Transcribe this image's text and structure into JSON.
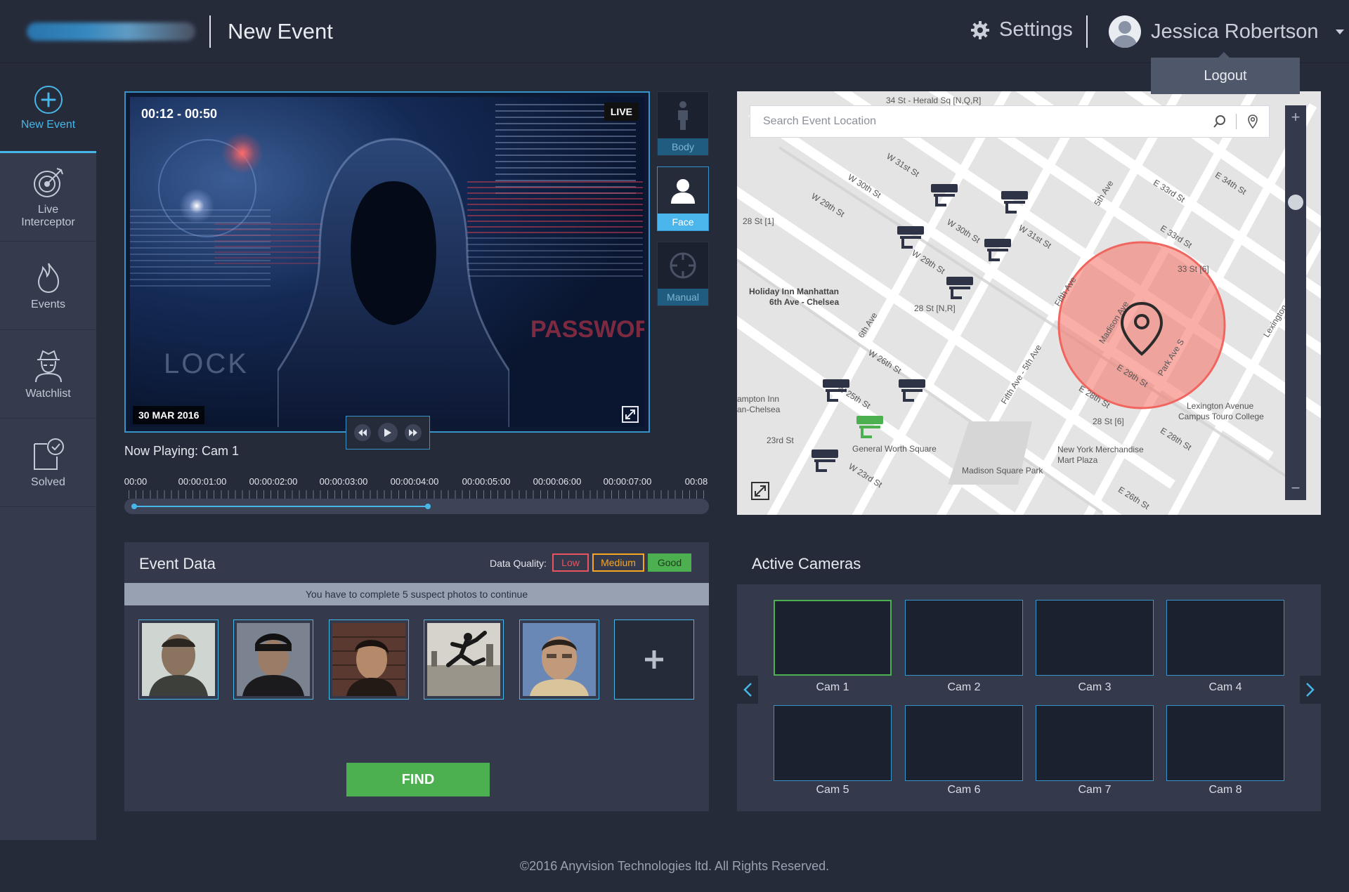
{
  "header": {
    "page_title": "New Event",
    "settings_label": "Settings",
    "user_name": "Jessica Robertson",
    "logout_label": "Logout"
  },
  "sidebar": {
    "items": [
      {
        "label": "New Event",
        "icon": "plus-circle-icon",
        "active": true
      },
      {
        "label": "Live Interceptor",
        "icon": "target-icon"
      },
      {
        "label": "Events",
        "icon": "flame-icon"
      },
      {
        "label": "Watchlist",
        "icon": "spy-icon"
      },
      {
        "label": "Solved",
        "icon": "check-document-icon"
      }
    ]
  },
  "video": {
    "time_range": "00:12 - 00:50",
    "live_label": "LIVE",
    "date": "30 MAR 2016",
    "now_playing": "Now Playing: Cam 1",
    "progress": 0.52
  },
  "modes": [
    {
      "label": "Body"
    },
    {
      "label": "Face",
      "active": true
    },
    {
      "label": "Manual"
    }
  ],
  "timeline": {
    "labels": [
      "00:00",
      "00:00:01:00",
      "00:00:02:00",
      "00:00:03:00",
      "00:00:04:00",
      "00:00:05:00",
      "00:00:06:00",
      "00:00:07:00",
      "00:08"
    ]
  },
  "map": {
    "search_placeholder": "Search Event Location",
    "labels": {
      "herald": "34 St - Herald Sq [N,Q,R]",
      "w31": "W 31st St",
      "w30": "W 30th St",
      "w29": "W 29th St",
      "st28a": "28 St [1]",
      "w30b": "W 30th St",
      "w29b": "W 29th St",
      "w31b": "W 31st St",
      "fifth": "5th Ave",
      "e34": "E 34th St",
      "e33": "E 33rd St",
      "e33b": "E 33rd St",
      "holiday": "Holiday Inn Manhattan",
      "holiday2": "6th Ave - Chelsea",
      "st28nr": "28 St [N,R]",
      "sixth": "6th Ave",
      "fifthave": "Fifth Ave",
      "st33": "33 St [6]",
      "madison": "Madison Ave",
      "parkave": "Park Ave S",
      "e29": "E 29th St",
      "lexington": "Lexington",
      "w26": "W 26th St",
      "w25": "W 25th St",
      "fifth5": "Fifth Ave - 5th Ave",
      "e28": "E 28th St",
      "lexave": "Lexington Avenue",
      "touro": "Campus Touro College",
      "hampton": "ampton Inn",
      "hampton2": "an-Chelsea",
      "st23": "23rd St",
      "genworth": "General Worth Square",
      "st28_6": "28 St [6]",
      "e28b": "E 28th St",
      "nymerch": "New York Merchandise",
      "martplaza": "Mart Plaza",
      "madsq": "Madison Square Park",
      "w23": "W 23rd St",
      "e26": "E 26th St"
    }
  },
  "event_data": {
    "title": "Event Data",
    "quality_label": "Data Quality:",
    "quality_low": "Low",
    "quality_medium": "Medium",
    "quality_good": "Good",
    "notice": "You have to complete 5 suspect photos to continue",
    "find_label": "FIND"
  },
  "cameras": {
    "title": "Active Cameras",
    "items": [
      "Cam 1",
      "Cam 2",
      "Cam 3",
      "Cam 4",
      "Cam 5",
      "Cam 6",
      "Cam 7",
      "Cam 8"
    ]
  },
  "footer": {
    "copyright": "©2016 Anyvision Technologies ltd. All Rights Reserved."
  },
  "colors": {
    "accent": "#47b6e8",
    "good": "#4caf50",
    "medium": "#f6a623",
    "low": "#e7545f",
    "background": "#262b3a",
    "panel": "#343a4c"
  }
}
